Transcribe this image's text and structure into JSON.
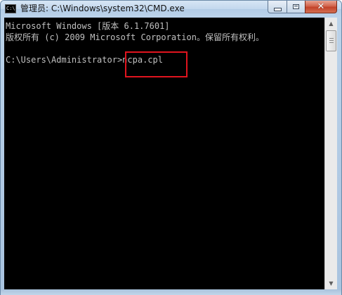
{
  "window": {
    "title": "管理员: C:\\Windows\\system32\\CMD.exe",
    "icon_label": "C:\\",
    "icon_name": "cmd-icon",
    "buttons": {
      "minimize_icon": "minimize-icon",
      "maximize_icon": "maximize-icon",
      "close_icon": "close-icon",
      "close_glyph": "✕"
    }
  },
  "console": {
    "lines": [
      "Microsoft Windows [版本 6.1.7601]",
      "版权所有 (c) 2009 Microsoft Corporation。保留所有权利。",
      "",
      "C:\\Users\\Administrator>ncpa.cpl"
    ],
    "text_color": "#c0c0c0",
    "background_color": "#000000",
    "highlight_color": "#e0141e"
  },
  "scrollbar": {
    "up_arrow": "▲",
    "down_arrow": "▼"
  }
}
